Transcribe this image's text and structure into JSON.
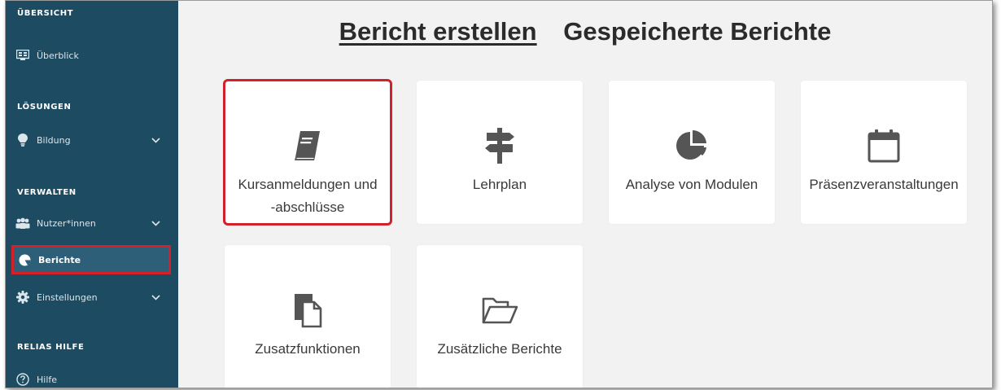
{
  "colors": {
    "sidebar_bg": "#1d4b62",
    "active_item_bg": "#2d5f78",
    "highlight_red": "#d4202a",
    "icon_gray": "#555555"
  },
  "sidebar": {
    "sections": [
      {
        "title": "ÜBERSICHT",
        "items": [
          {
            "label": "Überblick",
            "icon": "dashboard-icon"
          }
        ]
      },
      {
        "title": "LÖSUNGEN",
        "items": [
          {
            "label": "Bildung",
            "icon": "lightbulb-icon",
            "expandable": true
          }
        ]
      },
      {
        "title": "VERWALTEN",
        "items": [
          {
            "label": "Nutzer*innen",
            "icon": "users-icon",
            "expandable": true
          },
          {
            "label": "Berichte",
            "icon": "pie-chart-icon",
            "active": true
          },
          {
            "label": "Einstellungen",
            "icon": "gear-icon",
            "expandable": true
          }
        ]
      },
      {
        "title": "RELIAS HILFE",
        "items": [
          {
            "label": "Hilfe",
            "icon": "help-circle-icon"
          }
        ]
      }
    ]
  },
  "main": {
    "tabs": [
      {
        "label": "Bericht erstellen",
        "active": true
      },
      {
        "label": "Gespeicherte Berichte",
        "active": false
      }
    ],
    "cards": [
      {
        "label_line1": "Kursanmeldungen und",
        "label_line2": "-abschlüsse",
        "icon": "book-icon",
        "selected": true
      },
      {
        "label_line1": "Lehrplan",
        "label_line2": "",
        "icon": "signpost-icon"
      },
      {
        "label_line1": "Analyse von Modulen",
        "label_line2": "",
        "icon": "pie-chart-icon"
      },
      {
        "label_line1": "Präsenzveranstaltungen",
        "label_line2": "",
        "icon": "calendar-icon"
      },
      {
        "label_line1": "Zusatzfunktionen",
        "label_line2": "",
        "icon": "documents-icon"
      },
      {
        "label_line1": "Zusätzliche Berichte",
        "label_line2": "",
        "icon": "folder-open-icon"
      }
    ]
  }
}
